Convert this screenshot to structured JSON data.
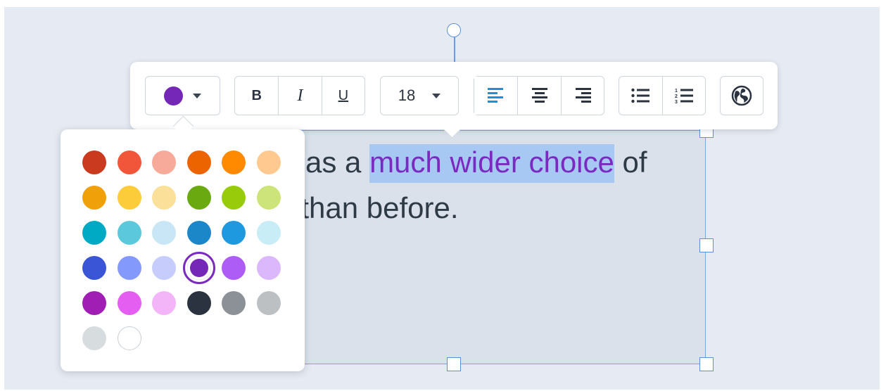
{
  "textbox": {
    "line1_prefix": "as a ",
    "line1_highlight": "much wider choice",
    "line1_suffix": " of",
    "line2": ". than before."
  },
  "toolbar": {
    "current_color": "#7528b8",
    "bold_label": "B",
    "italic_label": "I",
    "underline_label": "U",
    "font_size": "18",
    "accent_color": "#1e90d8",
    "icons": [
      "color-dropdown-caret",
      "align-left-icon",
      "align-center-icon",
      "align-right-icon",
      "bullet-list-icon",
      "numbered-list-icon",
      "globe-link-icon"
    ]
  },
  "color_picker": {
    "selected_index": 21,
    "swatches": [
      "#c93a1f",
      "#f2563a",
      "#f7a99a",
      "#eb6400",
      "#ff8a00",
      "#ffc98f",
      "#f0a008",
      "#fccc3a",
      "#fbe09a",
      "#6aaa10",
      "#98cc0a",
      "#cce47a",
      "#00aac5",
      "#5cc8dc",
      "#c9e6f6",
      "#1b86c8",
      "#1e98df",
      "#c8edf6",
      "#3a55d6",
      "#8399fb",
      "#c6cdfc",
      "#7528b8",
      "#ad5cf5",
      "#dab8fb",
      "#a01eb4",
      "#e45ef2",
      "#f4b4f8",
      "#2b3340",
      "#8b9196",
      "#bcc0c3",
      "#d7dcdf",
      "#ffffff"
    ]
  }
}
